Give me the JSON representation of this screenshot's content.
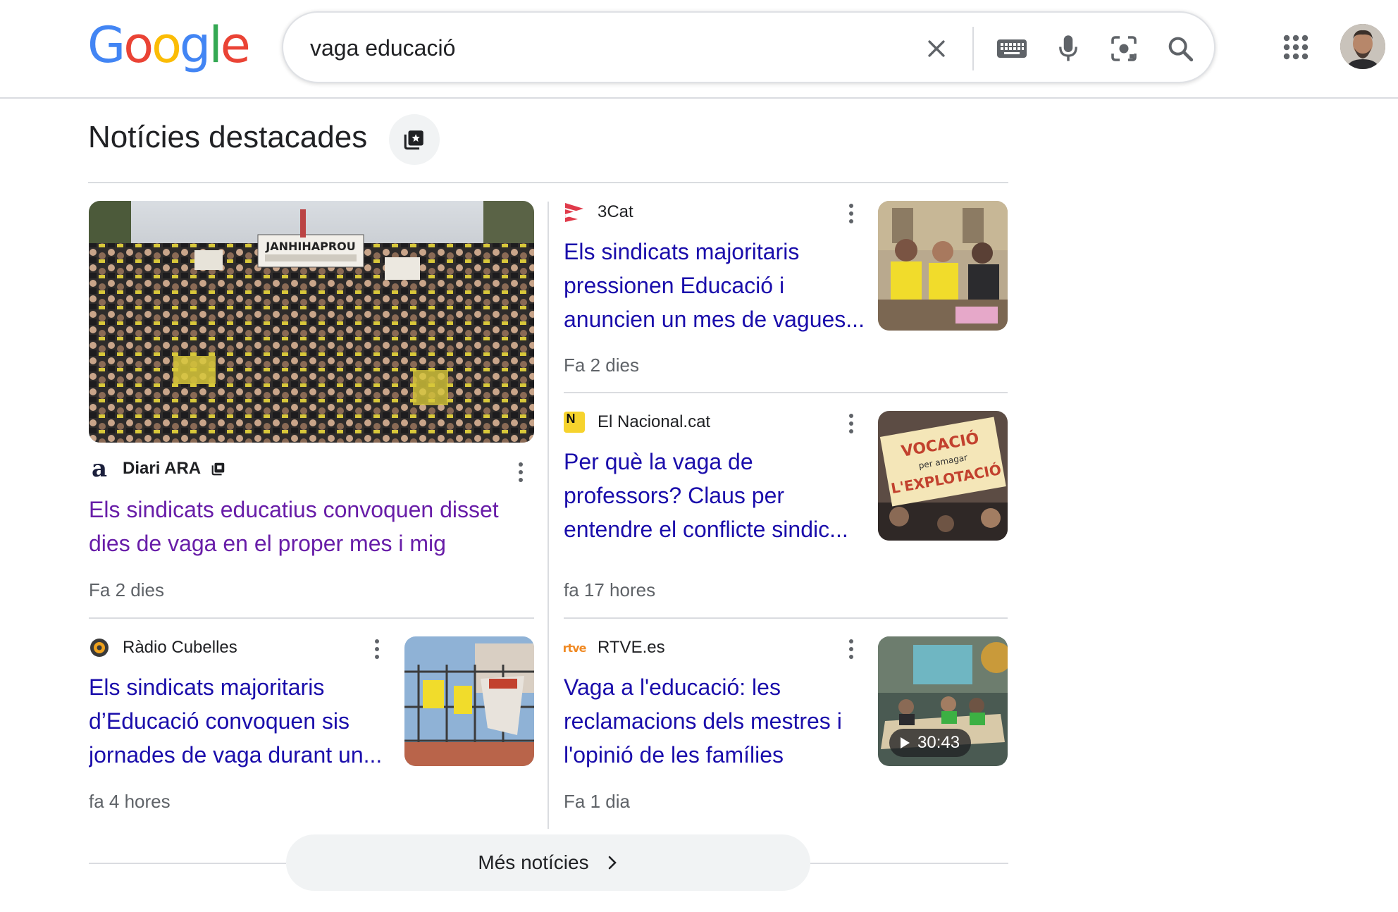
{
  "logo": {
    "text": "Google"
  },
  "search": {
    "query": "vaga educació"
  },
  "section": {
    "title": "Notícies destacades"
  },
  "articles": [
    {
      "source": "Diari ARA",
      "headline": "Els sindicats educatius convoquen disset dies de vaga en el proper mes i mig",
      "time": "Fa 2 dies"
    },
    {
      "source": "3Cat",
      "headline": "Els sindicats majoritaris pressionen Educació i anuncien un mes de vagues...",
      "time": "Fa 2 dies"
    },
    {
      "source": "El Nacional.cat",
      "headline": "Per què la vaga de professors? Claus per entendre el conflicte sindic...",
      "time": "fa 17 hores"
    },
    {
      "source": "Ràdio Cubelles",
      "headline": "Els sindicats majoritaris d’Educació convoquen sis jornades de vaga durant un...",
      "time": "fa 4 hores"
    },
    {
      "source": "RTVE.es",
      "headline": "Vaga a l'educació: les reclamacions dels mestres i l'opinió de les famílies",
      "time": "Fa 1 dia",
      "video_duration": "30:43"
    }
  ],
  "thumb_text": {
    "banner": "JANHIHAPROU",
    "sign": "VOCACIÓ",
    "sign_line2": "per amagar",
    "sign_line3": "L'EXPLOTACIÓ"
  },
  "source_logos": {
    "ara": "a",
    "nacional": "N",
    "rtve": "rtve"
  },
  "more_news": {
    "label": "Més notícies"
  },
  "colors": {
    "link": "#1a0dab",
    "visited": "#681da8",
    "meta": "#5f6368"
  }
}
